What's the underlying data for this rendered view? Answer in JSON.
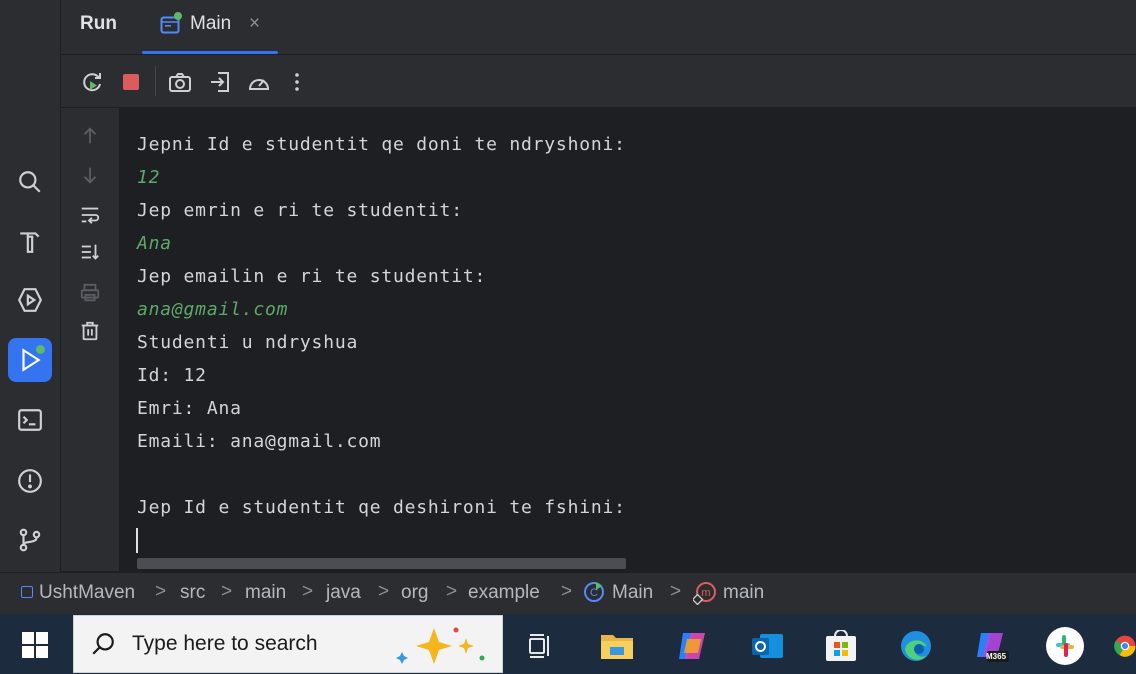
{
  "header": {
    "run_label": "Run",
    "tab_label": "Main",
    "close_glyph": "×"
  },
  "console": {
    "lines": [
      {
        "text": "Jepni Id e studentit qe doni te ndryshoni:",
        "kind": "output"
      },
      {
        "text": "12",
        "kind": "input"
      },
      {
        "text": "Jep emrin e ri te studentit:",
        "kind": "output"
      },
      {
        "text": "Ana",
        "kind": "input"
      },
      {
        "text": "Jep emailin e ri te studentit:",
        "kind": "output"
      },
      {
        "text": "ana@gmail.com",
        "kind": "input"
      },
      {
        "text": "Studenti u ndryshua",
        "kind": "output"
      },
      {
        "text": "Id: 12",
        "kind": "output"
      },
      {
        "text": "Emri: Ana",
        "kind": "output"
      },
      {
        "text": "Emaili: ana@gmail.com",
        "kind": "output"
      },
      {
        "text": "",
        "kind": "output"
      },
      {
        "text": "Jep Id e studentit qe deshironi te fshini:",
        "kind": "output"
      }
    ],
    "input_color": "#5ea96a",
    "output_color": "#d3d5da"
  },
  "breadcrumb": {
    "items": [
      "UshtMaven",
      "src",
      "main",
      "java",
      "org",
      "example",
      "Main",
      "main"
    ],
    "separator": ">"
  },
  "taskbar": {
    "search_placeholder": "Type here to search",
    "apps": [
      "task-view-icon",
      "file-explorer-icon",
      "copilot-icon",
      "outlook-icon",
      "microsoft-store-icon",
      "edge-icon",
      "m365-icon",
      "slack-icon",
      "chrome-icon"
    ],
    "m365_badge": "M365"
  },
  "colors": {
    "accent": "#3574f0",
    "panel": "#2b2d30",
    "editor_bg": "#1e1f22",
    "stop_red": "#db5c5c",
    "run_green": "#5fb865"
  }
}
